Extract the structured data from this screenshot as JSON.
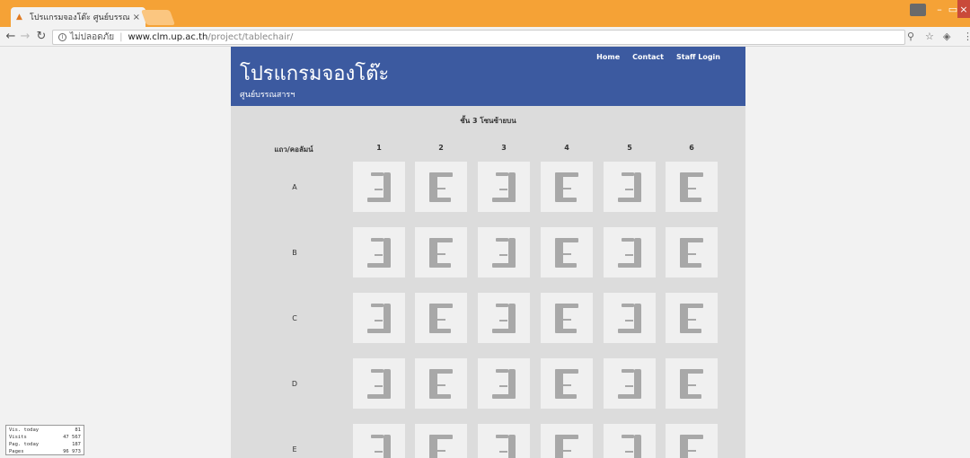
{
  "browser": {
    "tab_title": "โปรแกรมจองโต๊ะ ศูนย์บรรณ",
    "security_label": "ไม่ปลอดภัย",
    "url_host": "www.clm.up.ac.th",
    "url_path": "/project/tablechair/"
  },
  "site": {
    "title": "โปรแกรมจองโต๊ะ",
    "subtitle": "ศูนย์บรรณสารฯ",
    "nav": [
      "Home",
      "Contact",
      "Staff Login"
    ]
  },
  "floor": {
    "title": "ชั้น 3 โซนซ้ายบน",
    "corner_label": "แถว/คอลัมน์",
    "columns": [
      "1",
      "2",
      "3",
      "4",
      "5",
      "6"
    ],
    "rows": [
      "A",
      "B",
      "C",
      "D",
      "E"
    ]
  },
  "counter": [
    {
      "label": "Vis. today",
      "value": "81"
    },
    {
      "label": "Visits",
      "value": "47 567"
    },
    {
      "label": "Pag. today",
      "value": "187"
    },
    {
      "label": "Pages",
      "value": "96 973"
    }
  ],
  "icons": {
    "seat_facing_left": "chair-right-icon",
    "seat_facing_right": "chair-left-icon"
  },
  "colors": {
    "header_bg": "#3c5aa0",
    "titlebar": "#f5a236",
    "chair": "#a8a8a8",
    "seat_tile": "#f0f0f0"
  }
}
